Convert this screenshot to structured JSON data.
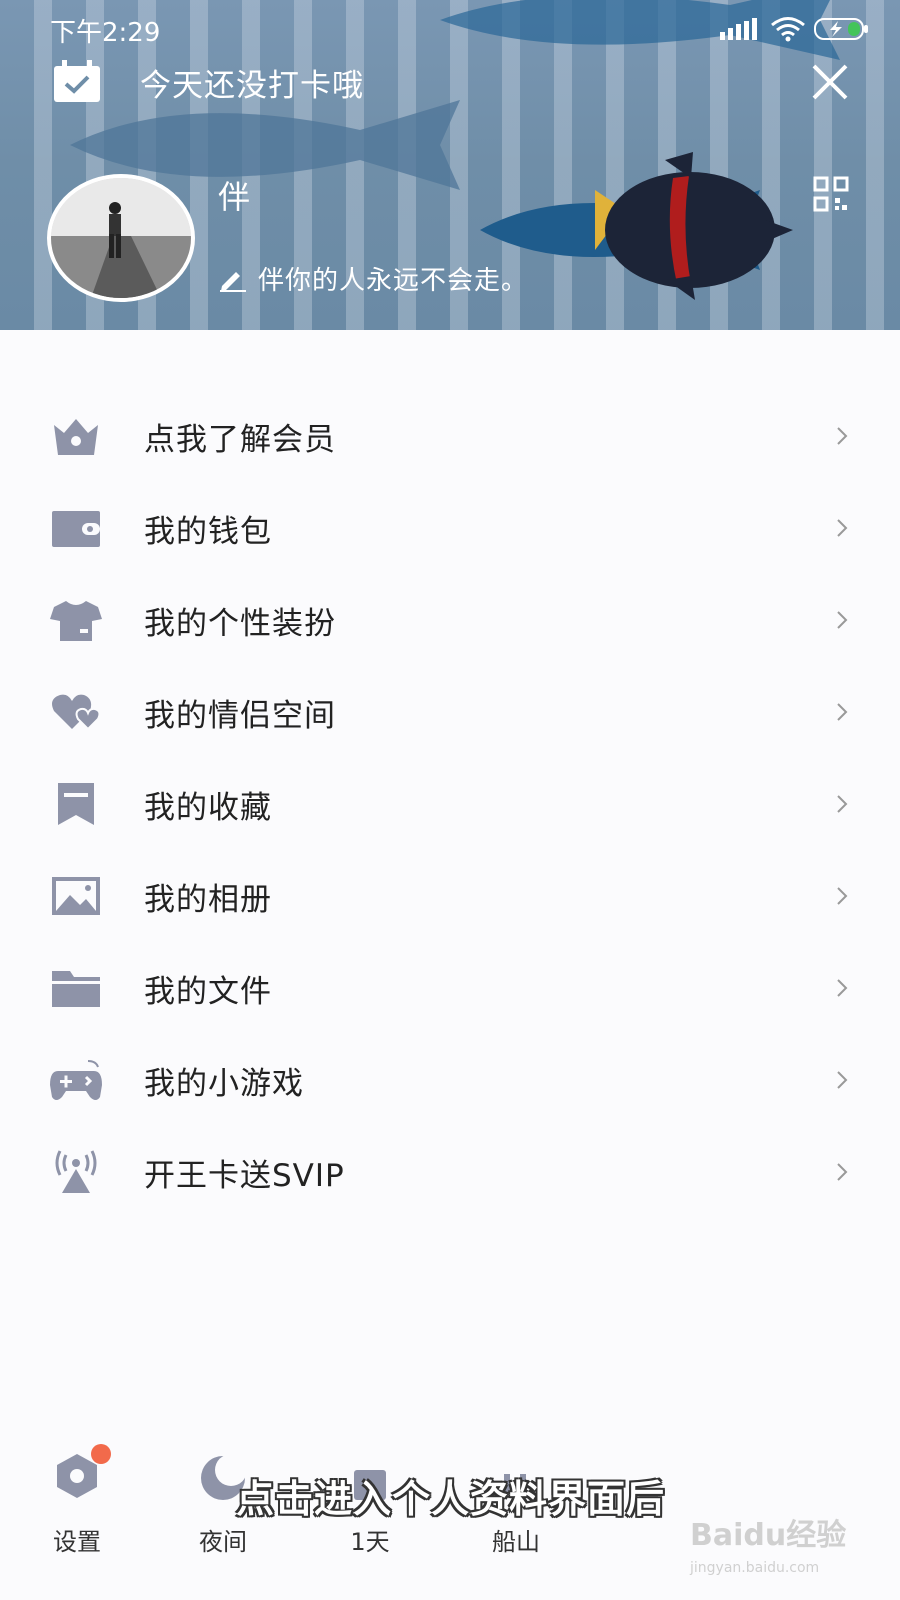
{
  "status": {
    "time": "下午2:29"
  },
  "header": {
    "checkin_text": "今天还没打卡哦",
    "username": "伴",
    "signature": "伴你的人永远不会走。"
  },
  "menu": [
    {
      "label": "点我了解会员",
      "icon": "crown-icon"
    },
    {
      "label": "我的钱包",
      "icon": "wallet-icon"
    },
    {
      "label": "我的个性装扮",
      "icon": "tshirt-icon"
    },
    {
      "label": "我的情侣空间",
      "icon": "hearts-icon"
    },
    {
      "label": "我的收藏",
      "icon": "bookmark-icon"
    },
    {
      "label": "我的相册",
      "icon": "photo-icon"
    },
    {
      "label": "我的文件",
      "icon": "folder-icon"
    },
    {
      "label": "我的小游戏",
      "icon": "gamepad-icon"
    },
    {
      "label": "开王卡送SVIP",
      "icon": "signal-tower-icon"
    }
  ],
  "bottom_nav": [
    {
      "label": "设置",
      "icon": "settings-icon"
    },
    {
      "label": "夜间",
      "icon": "moon-icon"
    },
    {
      "label": "1天",
      "icon": "calendar-icon"
    },
    {
      "label": "船山",
      "icon": "location-icon"
    }
  ],
  "subtitle": "点击进入个人资料界面后",
  "watermark": {
    "text": "Baidu经验",
    "sub": "jingyan.baidu.com"
  },
  "colors": {
    "icon": "#8e93a8",
    "header": "#7490ab",
    "badge": "#f26a4b"
  }
}
